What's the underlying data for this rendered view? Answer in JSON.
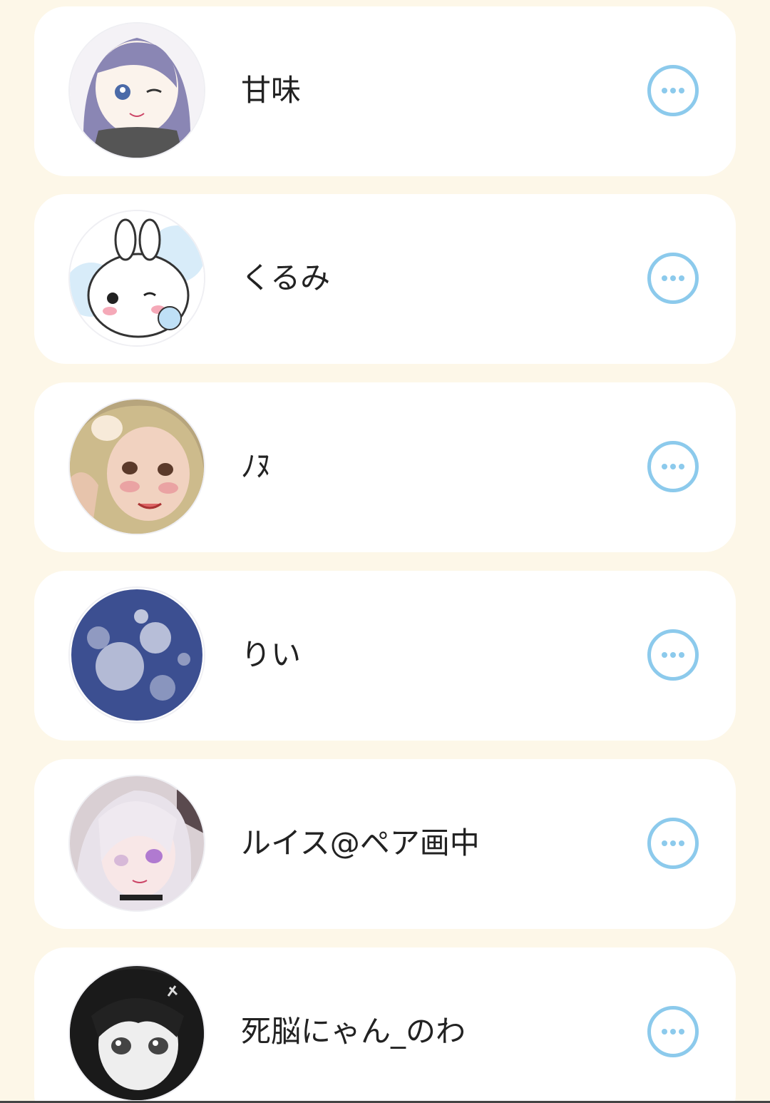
{
  "users": [
    {
      "name": "甘味",
      "avatar_icon": "avatar-purple-hair-girl-icon",
      "menu_icon": "more-options-icon"
    },
    {
      "name": "くるみ",
      "avatar_icon": "avatar-white-bunny-icon",
      "menu_icon": "more-options-icon"
    },
    {
      "name": "ﾉﾇ",
      "avatar_icon": "avatar-blonde-girl-icon",
      "menu_icon": "more-options-icon"
    },
    {
      "name": "りい",
      "avatar_icon": "avatar-moon-icon",
      "menu_icon": "more-options-icon"
    },
    {
      "name": "ルイス@ペア画中",
      "avatar_icon": "avatar-silver-hair-girl-icon",
      "menu_icon": "more-options-icon"
    },
    {
      "name": "死脳にゃん_のわ",
      "avatar_icon": "avatar-monochrome-girl-icon",
      "menu_icon": "more-options-icon"
    }
  ],
  "colors": {
    "background": "#fdf7e8",
    "card": "#ffffff",
    "accent": "#8ccaec",
    "text": "#222222"
  }
}
